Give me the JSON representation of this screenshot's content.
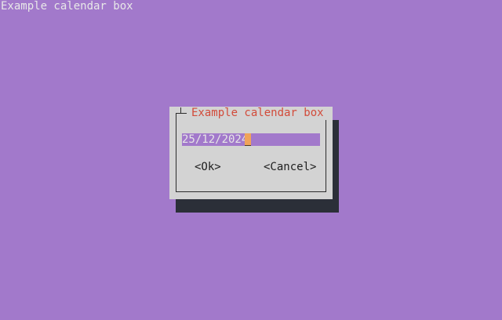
{
  "screen": {
    "title": "Example calendar box"
  },
  "dialog": {
    "title": "Example calendar box",
    "date_value": "25/12/2024",
    "ok_label": "<Ok>",
    "cancel_label": "<Cancel>"
  },
  "colors": {
    "background": "#a279cb",
    "dialog_body": "#d3d3d3",
    "dialog_title": "#d24b3a",
    "shadow": "#2b2f38",
    "cursor": "#f0a35a"
  }
}
